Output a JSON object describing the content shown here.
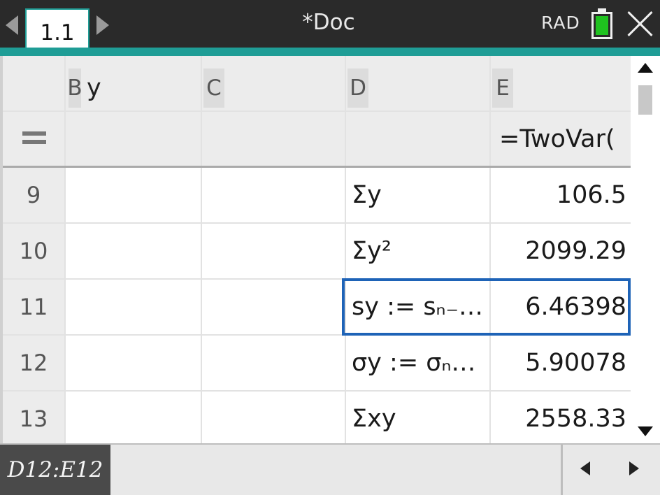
{
  "header": {
    "tab_label": "1.1",
    "doc_title": "*Doc",
    "angle_mode": "RAD"
  },
  "columns": {
    "b_letter": "B",
    "b_name": "y",
    "c_letter": "C",
    "d_letter": "D",
    "e_letter": "E"
  },
  "formula_row": {
    "e_formula": "=TwoVar("
  },
  "rows": [
    {
      "num": "9",
      "d": "Σy",
      "e": "106.5"
    },
    {
      "num": "10",
      "d": "Σy²",
      "e": "2099.29"
    },
    {
      "num": "11",
      "d": "sy := sₙ₋…",
      "e": "6.46398"
    },
    {
      "num": "12",
      "d": "σy := σₙ…",
      "e": "5.90078"
    },
    {
      "num": "13",
      "d": "Σxy",
      "e": "2558.33"
    }
  ],
  "status": {
    "cell_range": "D12:E12"
  },
  "colors": {
    "accent": "#1f9d96",
    "selection": "#1e63b7",
    "battery": "#1fc21f"
  }
}
